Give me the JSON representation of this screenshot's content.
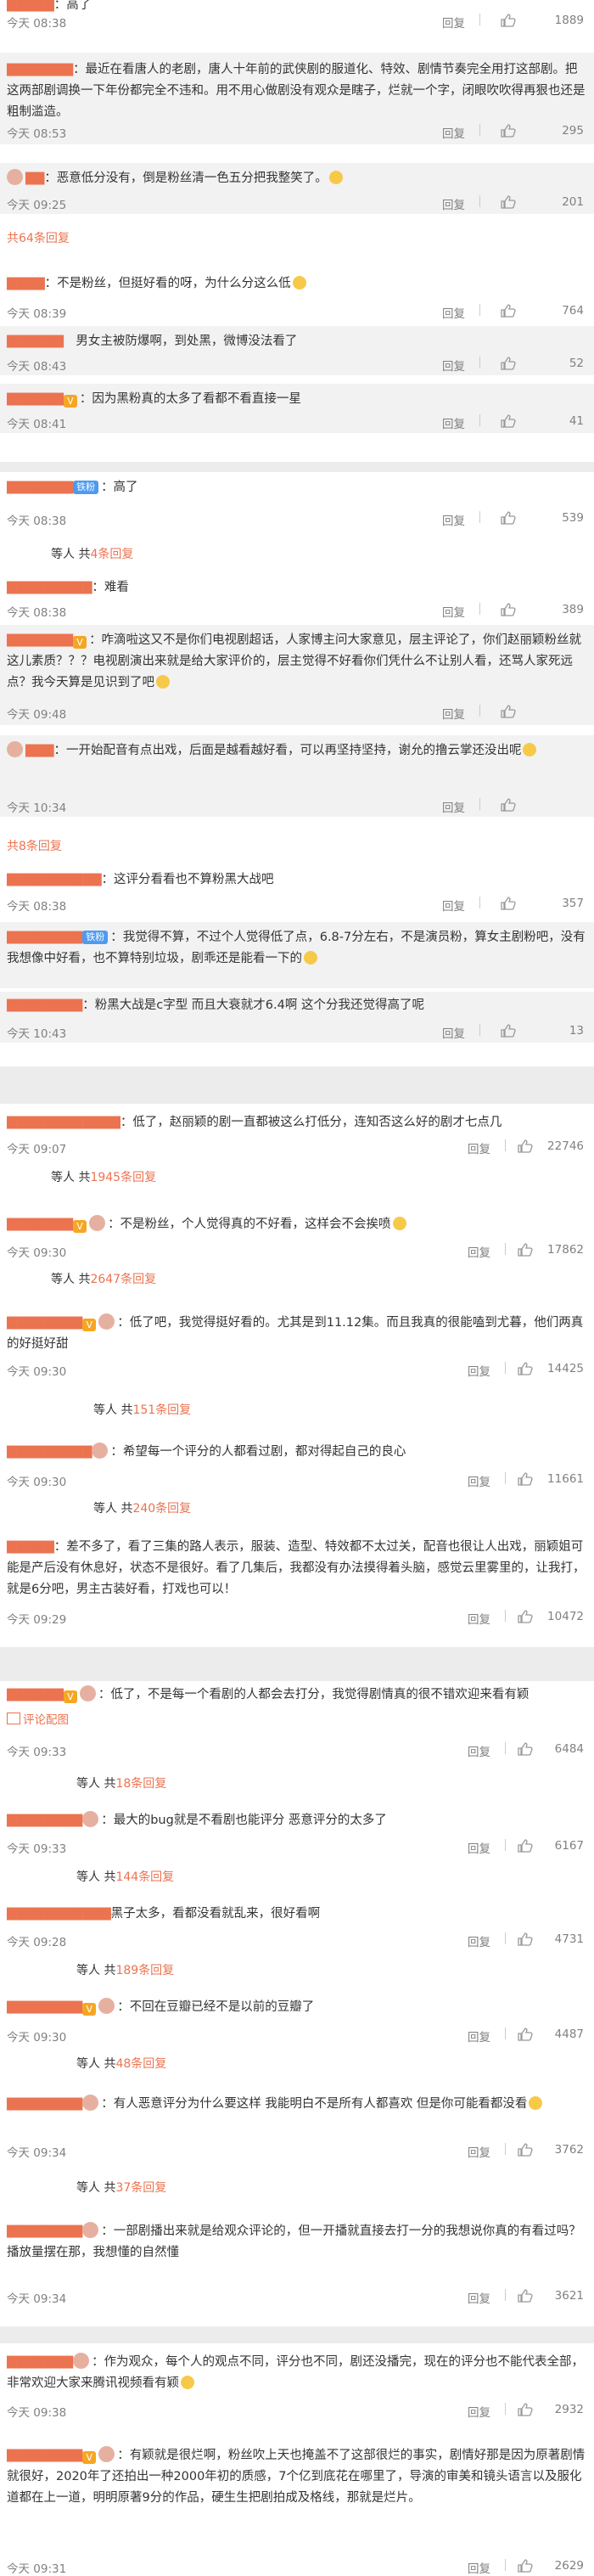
{
  "ui": {
    "reply": "回复",
    "more_prefix": "共",
    "more_suffix": "条回复",
    "more_prefix_short": "等人 共"
  },
  "card1": {
    "c0": {
      "text": "：高了",
      "time": "今天 08:38",
      "likes": "1889"
    },
    "c1": {
      "text": "：最近在看唐人的老剧，唐人十年前的武侠剧的服道化、特效、剧情节奏完全用打这部剧。把这两部剧调换一下年份都完全不违和。用不用心做剧没有观众是瞎子，烂就一个字，闭眼吹吹得再狠也还是粗制滥造。",
      "time": "今天 08:53",
      "likes": "295"
    },
    "c2": {
      "text": "：恶意低分没有，倒是粉丝清一色五分把我整笑了。",
      "time": "今天 09:25",
      "likes": "201"
    },
    "c2_more": {
      "count": "64"
    },
    "c3": {
      "text": "：不是粉丝，但挺好看的呀，为什么分这么低",
      "time": "今天 08:39",
      "likes": "764"
    },
    "c4": {
      "text": "男女主被防爆啊，到处黑，微博没法看了",
      "time": "今天 08:43",
      "likes": "52"
    },
    "c5": {
      "text": "：因为黑粉真的太多了看都不看直接一星",
      "time": "今天 08:41",
      "likes": "41"
    }
  },
  "card2": {
    "c0": {
      "tag": "铁粉",
      "text": "：高了",
      "time": "今天 08:38",
      "likes": "539"
    },
    "c0_more": {
      "count": "4"
    },
    "c1": {
      "text": "：难看",
      "time": "今天 08:38",
      "likes": "389"
    },
    "c2": {
      "text": "：咋滴啦这又不是你们电视剧超话，人家博主问大家意见，层主评论了，你们赵丽颖粉丝就这儿素质？？？电视剧演出来就是给大家评价的，层主觉得不好看你们凭什么不让别人看，还骂人家死远点？我今天算是见识到了吧",
      "time": "今天 09:48",
      "likes": ""
    },
    "c3": {
      "text": "：一开始配音有点出戏，后面是越看越好看，可以再坚持坚持，谢允的撸云掌还没出呢",
      "time": "今天 10:34",
      "likes": ""
    },
    "c3_more": {
      "count": "8"
    },
    "c4": {
      "text": "：这评分看看也不算粉黑大战吧",
      "time": "今天 08:38",
      "likes": "357"
    },
    "c5": {
      "tag": "铁粉",
      "text": "：我觉得不算，不过个人觉得低了点，6.8-7分左右，不是演员粉，算女主剧粉吧，没有我想像中好看，也不算特别垃圾，剧乖还是能看一下的",
      "time": "",
      "likes": ""
    },
    "c6": {
      "text": "：粉黑大战是c字型 而且大衰就才6.4啊 这个分我还觉得高了呢",
      "time": "今天 10:43",
      "likes": "13"
    }
  },
  "card3": {
    "c0": {
      "text": "：低了，赵丽颖的剧一直都被这么打低分，连知否这么好的剧才七点几",
      "time": "今天 09:07",
      "likes": "22746"
    },
    "c0_more": {
      "count": "1945"
    },
    "c1": {
      "text": "：不是粉丝，个人觉得真的不好看，这样会不会挨喷",
      "time": "今天 09:30",
      "likes": "17862"
    },
    "c1_more": {
      "count": "2647"
    },
    "c2": {
      "text": "：低了吧，我觉得挺好看的。尤其是到11.12集。而且我真的很能嗑到尤暮，他们两真的好挺好甜",
      "time": "今天 09:30",
      "likes": "14425"
    },
    "c2_more": {
      "count": "151"
    },
    "c3": {
      "text": "：希望每一个评分的人都看过剧，都对得起自己的良心",
      "time": "今天 09:30",
      "likes": "11661"
    },
    "c3_more": {
      "count": "240"
    },
    "c4": {
      "text": "：差不多了，看了三集的路人表示，服装、造型、特效都不太过关，配音也很让人出戏，丽颖姐可能是产后没有休息好，状态不是很好。看了几集后，我都没有办法摸得着头脑，感觉云里雾里的，让我打，就是6分吧，男主古装好看，打戏也可以！",
      "time": "今天 09:29",
      "likes": "10472"
    }
  },
  "card4": {
    "c0": {
      "text": "：低了，不是每一个看剧的人都会去打分，我觉得剧情真的很不错欢迎来看有颖",
      "pic": "评论配图",
      "time": "今天 09:33",
      "likes": "6484"
    },
    "c0_more": {
      "count": "18"
    },
    "c1": {
      "text": "：最大的bug就是不看剧也能评分 恶意评分的太多了",
      "time": "今天 09:33",
      "likes": "6167"
    },
    "c1_more": {
      "count": "144"
    },
    "c2": {
      "text": "黑子太多，看都没看就乱来，很好看啊",
      "time": "今天 09:28",
      "likes": "4731"
    },
    "c2_more": {
      "count": "189"
    },
    "c3": {
      "text": "：不回在豆瓣已经不是以前的豆瓣了",
      "time": "今天 09:30",
      "likes": "4487"
    },
    "c3_more": {
      "count": "48"
    },
    "c4": {
      "text": "：有人恶意评分为什么要这样 我能明白不是所有人都喜欢 但是你可能看都没看",
      "time": "今天 09:34",
      "likes": "3762"
    },
    "c4_more": {
      "count": "37"
    },
    "c5": {
      "text": "：一部剧播出来就是给观众评论的，但一开播就直接去打一分的我想说你真的有看过吗？播放量摆在那，我想懂的自然懂",
      "time": "今天 09:34",
      "likes": "3621"
    }
  },
  "card5": {
    "c0": {
      "text": "：作为观众，每个人的观点不同，评分也不同，剧还没播完，现在的评分也不能代表全部，非常欢迎大家来腾讯视频看有颖",
      "time": "今天 09:38",
      "likes": "2932"
    },
    "c1": {
      "text": "：有颖就是很烂啊，粉丝吹上天也掩盖不了这部很烂的事实，剧情好那是因为原著剧情就很好，2020年了还拍出一种2000年初的质感，7个亿到底花在哪里了，导演的审美和镜头语言以及服化道都在上一道，明明原著9分的作品，硬生生把剧拍成及格线，那就是烂片。",
      "time": "今天 09:31",
      "likes": "2629"
    }
  }
}
